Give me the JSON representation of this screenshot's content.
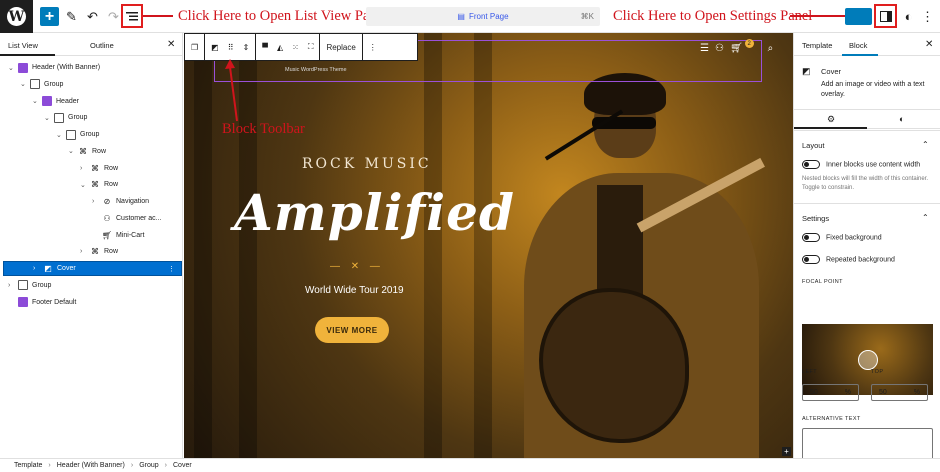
{
  "annotations": {
    "list_view": "Click Here to Open List View Panel",
    "settings": "Click Here to Open Settings Panel",
    "block_toolbar": "Block Toolbar"
  },
  "command_bar": {
    "label": "Front Page",
    "shortcut": "⌘K"
  },
  "left_panel": {
    "tabs": [
      "List View",
      "Outline"
    ],
    "tree": [
      {
        "label": "Header (With Banner)",
        "icon": "template-part-icon"
      },
      {
        "label": "Group",
        "icon": "group-icon"
      },
      {
        "label": "Header",
        "icon": "template-part-icon"
      },
      {
        "label": "Group",
        "icon": "group-icon"
      },
      {
        "label": "Group",
        "icon": "group-icon"
      },
      {
        "label": "Row",
        "icon": "row-icon"
      },
      {
        "label": "Row",
        "icon": "row-icon"
      },
      {
        "label": "Row",
        "icon": "row-icon"
      },
      {
        "label": "Navigation",
        "icon": "navigation-icon"
      },
      {
        "label": "Customer ac...",
        "icon": "customer-account-icon"
      },
      {
        "label": "Mini-Cart",
        "icon": "cart-icon"
      },
      {
        "label": "Row",
        "icon": "row-icon"
      },
      {
        "label": "Cover",
        "icon": "cover-icon"
      },
      {
        "label": "Group",
        "icon": "group-icon"
      },
      {
        "label": "Footer Default",
        "icon": "template-part-icon"
      }
    ]
  },
  "canvas": {
    "theme_label": "Music WordPress Theme",
    "replace_label": "Replace",
    "cart_count": "2",
    "kicker": "ROCK MUSIC",
    "headline": "Amplified",
    "ornament": "— ✕ —",
    "tour": "World Wide Tour 2019",
    "cta": "VIEW MORE"
  },
  "right_panel": {
    "tabs": [
      "Template",
      "Block"
    ],
    "block_name": "Cover",
    "block_desc": "Add an image or video with a text overlay.",
    "layout_title": "Layout",
    "inner_blocks_label": "Inner blocks use content width",
    "inner_blocks_help": "Nested blocks will fill the width of this container. Toggle to constrain.",
    "settings_title": "Settings",
    "fixed_bg_label": "Fixed background",
    "repeated_bg_label": "Repeated background",
    "focal_label": "FOCAL POINT",
    "left_label": "LEFT",
    "top_label": "TOP",
    "left_value": "50",
    "top_value": "50",
    "percent": "%",
    "alt_label": "ALTERNATIVE TEXT"
  },
  "breadcrumb": [
    "Template",
    "Header (With Banner)",
    "Group",
    "Cover"
  ],
  "colors": {
    "accent": "#007cba",
    "selection": "#006fd0",
    "annotation": "#d0141c",
    "button": "#f0b33b"
  }
}
